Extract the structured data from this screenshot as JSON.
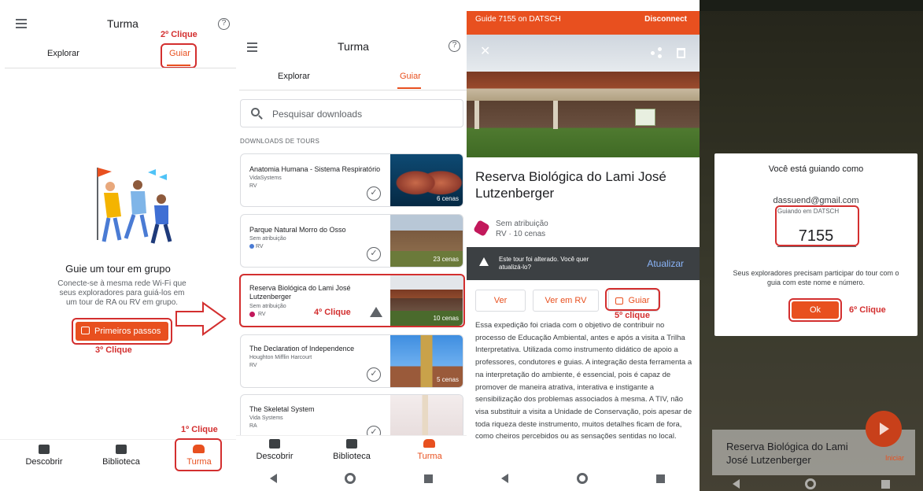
{
  "panel1": {
    "title": "Turma",
    "tabs": [
      "Explorar",
      "Guiar"
    ],
    "heading": "Guie um tour em grupo",
    "description": "Conecte-se à mesma rede Wi-Fi que seus exploradores para guiá-los em um tour de RA ou RV em grupo.",
    "cta_label": "Primeiros passos",
    "bottom_nav": [
      "Descobrir",
      "Biblioteca",
      "Turma"
    ],
    "annotations": {
      "step1": "1º Clique",
      "step2": "2º Clique",
      "step3": "3º Clique"
    }
  },
  "panel2": {
    "title": "Turma",
    "tabs": [
      "Explorar",
      "Guiar"
    ],
    "search_placeholder": "Pesquisar downloads",
    "section_header": "DOWNLOADS DE TOURS",
    "tours": [
      {
        "title": "Anatomia Humana - Sistema Respiratório",
        "author": "VidaSystems",
        "type": "RV",
        "scenes": "6 cenas"
      },
      {
        "title": "Parque Natural Morro do Osso",
        "author": "Sem atribuição",
        "type": "RV",
        "scenes": "23 cenas"
      },
      {
        "title": "Reserva Biológica do Lami José Lutzenberger",
        "author": "Sem atribuição",
        "type": "RV",
        "scenes": "10 cenas"
      },
      {
        "title": "The Declaration of Independence",
        "author": "Houghton Mifflin Harcourt",
        "type": "RV",
        "scenes": "5 cenas"
      },
      {
        "title": "The Skeletal System",
        "author": "Vida Systems",
        "type": "RA",
        "scenes": ""
      }
    ],
    "bottom_nav": [
      "Descobrir",
      "Biblioteca",
      "Turma"
    ],
    "annotations": {
      "step4": "4º Clique"
    }
  },
  "panel3": {
    "status_text": "Guide 7155 on DATSCH",
    "disconnect_label": "Disconnect",
    "tour_title": "Reserva Biológica do Lami José Lutzenberger",
    "attribution": "Sem atribuição",
    "meta": "RV · 10 cenas",
    "alert_text": "Este tour foi alterado. Você quer atualizá-lo?",
    "update_label": "Atualizar",
    "buttons": [
      "Ver",
      "Ver em RV",
      "Guiar"
    ],
    "description": "Essa expedição foi criada com o objetivo de contribuir no processo de Educação Ambiental, antes e após a visita a Trilha Interpretativa. Utilizada como instrumento didático de apoio a professores, condutores e guias. A integração desta ferramenta a na interpretação do ambiente, é essencial, pois é capaz de promover de maneira atrativa, interativa e instigante a sensibilização dos problemas associados à mesma. A TIV, não visa substituir a visita a Unidade de Conservação, pois apesar de toda riqueza deste instrumento, muitos detalhes ficam de fora, como cheiros percebidos ou as sensações sentidas no local.",
    "annotations": {
      "step5": "5º clique"
    }
  },
  "panel4": {
    "dialog_title": "Você está guiando como",
    "email": "dassuend@gmail.com",
    "network_label": "Guiando em DATSCH",
    "number": "7155",
    "note": "Seus exploradores precisam participar do tour com o guia com este nome e número.",
    "ok_label": "Ok",
    "bottom_title": "Reserva Biológica do Lami José Lutzenberger",
    "start_label": "Iniciar",
    "annotations": {
      "step6": "6º Clique"
    }
  },
  "colors": {
    "accent": "#e8501f",
    "annotation": "#d32f2f",
    "alert_bg": "#3c4043"
  }
}
